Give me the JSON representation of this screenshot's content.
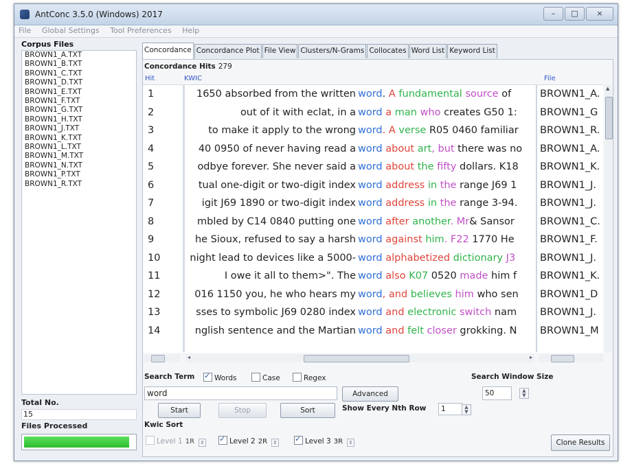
{
  "window": {
    "title": "AntConc 3.5.0 (Windows) 2017",
    "minimize": "–",
    "maximize": "□",
    "close": "×"
  },
  "menu": [
    "File",
    "Global Settings",
    "Tool Preferences",
    "Help"
  ],
  "corpus": {
    "title": "Corpus Files",
    "files": [
      "BROWN1_A.TXT",
      "BROWN1_B.TXT",
      "BROWN1_C.TXT",
      "BROWN1_D.TXT",
      "BROWN1_E.TXT",
      "BROWN1_F.TXT",
      "BROWN1_G.TXT",
      "BROWN1_H.TXT",
      "BROWN1_J.TXT",
      "BROWN1_K.TXT",
      "BROWN1_L.TXT",
      "BROWN1_M.TXT",
      "BROWN1_N.TXT",
      "BROWN1_P.TXT",
      "BROWN1_R.TXT"
    ],
    "total_label": "Total No.",
    "total_value": "15",
    "processed_label": "Files Processed",
    "progress_fraction": 0.97
  },
  "tabs": [
    "Concordance",
    "Concordance Plot",
    "File View",
    "Clusters/N-Grams",
    "Collocates",
    "Word List",
    "Keyword List"
  ],
  "active_tab": 0,
  "concordance": {
    "hits_label": "Concordance Hits",
    "hits_count": "279",
    "col_hit": "Hit",
    "col_kwic": "KWIC",
    "col_file": "File",
    "rows": [
      {
        "hit": "1",
        "left": "1650 absorbed from the written ",
        "right": [
          {
            "t": "word",
            "c": "#2f6fd6"
          },
          {
            "t": ". ",
            "c": "#222"
          },
          {
            "t": " A ",
            "c": "#e0443a"
          },
          {
            "t": "fundamental ",
            "c": "#2fb34a"
          },
          {
            "t": "source",
            "c": "#c04fc6"
          },
          {
            "t": " of",
            "c": "#222"
          }
        ],
        "file": "BROWN1_A."
      },
      {
        "hit": "2",
        "left": "out of it with eclat, in a ",
        "right": [
          {
            "t": "word",
            "c": "#2f6fd6"
          },
          {
            "t": " a ",
            "c": "#e0443a"
          },
          {
            "t": "man ",
            "c": "#2fb34a"
          },
          {
            "t": "who",
            "c": "#c04fc6"
          },
          {
            "t": " creates G50 1:",
            "c": "#222"
          }
        ],
        "file": "BROWN1_G"
      },
      {
        "hit": "3",
        "left": "to make it apply to the wrong ",
        "right": [
          {
            "t": "word",
            "c": "#2f6fd6"
          },
          {
            "t": ". A ",
            "c": "#e0443a"
          },
          {
            "t": "verse",
            "c": "#2fb34a"
          },
          {
            "t": " R05 0460 familiar",
            "c": "#222"
          }
        ],
        "file": "BROWN1_R."
      },
      {
        "hit": "4",
        "left": "40 0950 of never having read a ",
        "right": [
          {
            "t": "word",
            "c": "#2f6fd6"
          },
          {
            "t": " about ",
            "c": "#e0443a"
          },
          {
            "t": "art",
            "c": "#2fb34a"
          },
          {
            "t": ", but",
            "c": "#c04fc6"
          },
          {
            "t": " there was no",
            "c": "#222"
          }
        ],
        "file": "BROWN1_A."
      },
      {
        "hit": "5",
        "left": "odbye forever. She never said a ",
        "right": [
          {
            "t": "word",
            "c": "#2f6fd6"
          },
          {
            "t": " about ",
            "c": "#e0443a"
          },
          {
            "t": "the ",
            "c": "#2fb34a"
          },
          {
            "t": "fifty",
            "c": "#c04fc6"
          },
          {
            "t": " dollars. K18",
            "c": "#222"
          }
        ],
        "file": "BROWN1_K."
      },
      {
        "hit": "6",
        "left": "tual one-digit or two-digit index ",
        "right": [
          {
            "t": "word",
            "c": "#2f6fd6"
          },
          {
            "t": " address ",
            "c": "#e0443a"
          },
          {
            "t": "in ",
            "c": "#2fb34a"
          },
          {
            "t": "the",
            "c": "#c04fc6"
          },
          {
            "t": " range J69 1",
            "c": "#222"
          }
        ],
        "file": "BROWN1_J."
      },
      {
        "hit": "7",
        "left": "igit J69 1890 or two-digit index ",
        "right": [
          {
            "t": "word",
            "c": "#2f6fd6"
          },
          {
            "t": " address ",
            "c": "#e0443a"
          },
          {
            "t": "in ",
            "c": "#2fb34a"
          },
          {
            "t": "the",
            "c": "#c04fc6"
          },
          {
            "t": " range 3-94.",
            "c": "#222"
          }
        ],
        "file": "BROWN1_J."
      },
      {
        "hit": "8",
        "left": "mbled by C14 0840 putting one ",
        "right": [
          {
            "t": "word",
            "c": "#2f6fd6"
          },
          {
            "t": " after ",
            "c": "#e0443a"
          },
          {
            "t": "another",
            "c": "#2fb34a"
          },
          {
            "t": ". Mr",
            "c": "#c04fc6"
          },
          {
            "t": "& Sansor",
            "c": "#222"
          }
        ],
        "file": "BROWN1_C."
      },
      {
        "hit": "9",
        "left": "he Sioux, refused to say a harsh ",
        "right": [
          {
            "t": "word",
            "c": "#2f6fd6"
          },
          {
            "t": " against ",
            "c": "#e0443a"
          },
          {
            "t": "him",
            "c": "#2fb34a"
          },
          {
            "t": ". F22",
            "c": "#c04fc6"
          },
          {
            "t": " 1770 He",
            "c": "#222"
          }
        ],
        "file": "BROWN1_F."
      },
      {
        "hit": "10",
        "left": "night lead to devices like a 5000-",
        "right": [
          {
            "t": "word",
            "c": "#2f6fd6"
          },
          {
            "t": " alphabetized ",
            "c": "#e0443a"
          },
          {
            "t": "dictionary",
            "c": "#2fb34a"
          },
          {
            "t": " J3",
            "c": "#c04fc6"
          }
        ],
        "file": "BROWN1_J."
      },
      {
        "hit": "11",
        "left": "I owe it all to them>\". The ",
        "right": [
          {
            "t": "word",
            "c": "#2f6fd6"
          },
          {
            "t": " also ",
            "c": "#e0443a"
          },
          {
            "t": "K07",
            "c": "#2fb34a"
          },
          {
            "t": " 0520 ",
            "c": "#222"
          },
          {
            "t": "made",
            "c": "#c04fc6"
          },
          {
            "t": " him f",
            "c": "#222"
          }
        ],
        "file": "BROWN1_K."
      },
      {
        "hit": "12",
        "left": "016 1150 you, he who hears my ",
        "right": [
          {
            "t": "word",
            "c": "#2f6fd6"
          },
          {
            "t": ", and ",
            "c": "#e0443a"
          },
          {
            "t": "believes ",
            "c": "#2fb34a"
          },
          {
            "t": "him",
            "c": "#c04fc6"
          },
          {
            "t": " who sen",
            "c": "#222"
          }
        ],
        "file": "BROWN1_D"
      },
      {
        "hit": "13",
        "left": "sses to symbolic J69 0280 index ",
        "right": [
          {
            "t": "word",
            "c": "#2f6fd6"
          },
          {
            "t": " and ",
            "c": "#e0443a"
          },
          {
            "t": "electronic ",
            "c": "#2fb34a"
          },
          {
            "t": "switch",
            "c": "#c04fc6"
          },
          {
            "t": " nam",
            "c": "#222"
          }
        ],
        "file": "BROWN1_J."
      },
      {
        "hit": "14",
        "left": "nglish sentence and the Martian ",
        "right": [
          {
            "t": "word",
            "c": "#2f6fd6"
          },
          {
            "t": " and ",
            "c": "#e0443a"
          },
          {
            "t": "felt ",
            "c": "#2fb34a"
          },
          {
            "t": "closer",
            "c": "#c04fc6"
          },
          {
            "t": " grokking. N",
            "c": "#222"
          }
        ],
        "file": "BROWN1_M"
      }
    ]
  },
  "search": {
    "label": "Search Term",
    "words_label": "Words",
    "case_label": "Case",
    "regex_label": "Regex",
    "value": "word",
    "advanced_label": "Advanced",
    "window_label": "Search Window Size",
    "window_value": "50",
    "start_label": "Start",
    "stop_label": "Stop",
    "sort_label": "Sort",
    "nth_label": "Show Every Nth Row",
    "nth_value": "1"
  },
  "kwic_sort": {
    "label": "Kwic Sort",
    "levels": [
      {
        "label": "Level 1",
        "value": "1R"
      },
      {
        "label": "Level 2",
        "value": "2R"
      },
      {
        "label": "Level 3",
        "value": "3R"
      }
    ],
    "clone_label": "Clone Results"
  }
}
